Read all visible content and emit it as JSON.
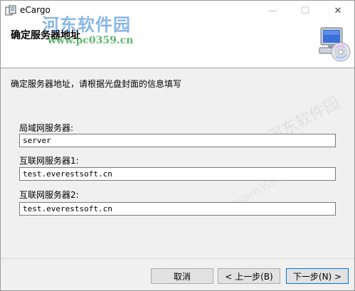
{
  "window": {
    "title": "eCargo",
    "minimize_glyph": "—",
    "maximize_glyph": "☐",
    "close_glyph": "✕"
  },
  "header": {
    "title": "确定服务器地址",
    "icon": "computer-cd-icon"
  },
  "watermark": {
    "brand": "河东软件园",
    "url": "www.pc0359.cn",
    "faint_brand": "河东软件园",
    "faint_url": "www.pc0359.cn"
  },
  "body": {
    "instruction": "确定服务器地址，请根据光盘封面的信息填写",
    "fields": [
      {
        "label": "局域网服务器:",
        "value": "server"
      },
      {
        "label": "互联网服务器1:",
        "value": "test.everestsoft.cn"
      },
      {
        "label": "互联网服务器2:",
        "value": "test.everestsoft.cn"
      }
    ]
  },
  "buttons": {
    "cancel": "取消",
    "prev": "< 上一步(B)",
    "next": "下一步(N) >"
  },
  "colors": {
    "accent": "#0078d7",
    "watermark_blue": "#2b7cd3",
    "watermark_green": "#3aa54a"
  }
}
